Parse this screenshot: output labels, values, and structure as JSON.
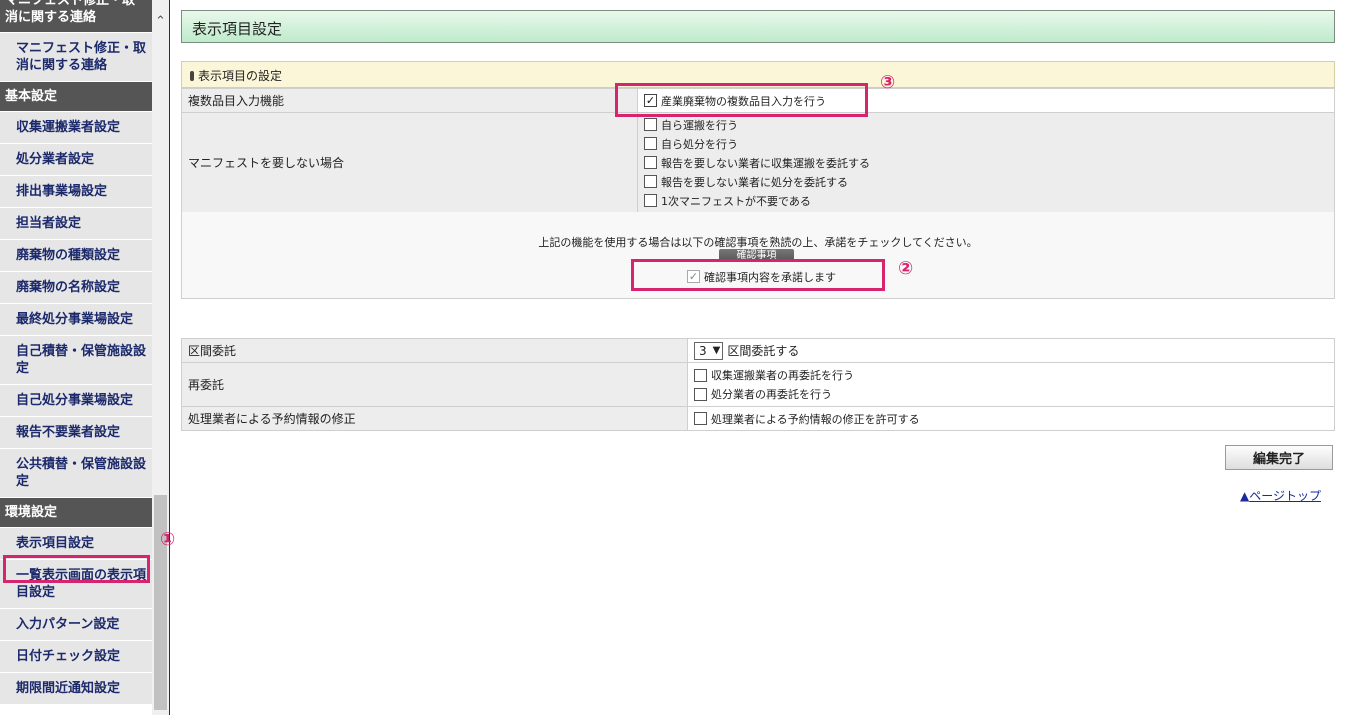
{
  "sidebar": {
    "items": [
      {
        "type": "header",
        "label": "マニフェスト修正・取消に関する連絡"
      },
      {
        "type": "item",
        "label": "マニフェスト修正・取消に関する連絡"
      },
      {
        "type": "header",
        "label": "基本設定"
      },
      {
        "type": "item",
        "label": "収集運搬業者設定"
      },
      {
        "type": "item",
        "label": "処分業者設定"
      },
      {
        "type": "item",
        "label": "排出事業場設定"
      },
      {
        "type": "item",
        "label": "担当者設定"
      },
      {
        "type": "item",
        "label": "廃棄物の種類設定"
      },
      {
        "type": "item",
        "label": "廃棄物の名称設定"
      },
      {
        "type": "item",
        "label": "最終処分事業場設定"
      },
      {
        "type": "item",
        "label": "自己積替・保管施設設定"
      },
      {
        "type": "item",
        "label": "自己処分事業場設定"
      },
      {
        "type": "item",
        "label": "報告不要業者設定"
      },
      {
        "type": "item",
        "label": "公共積替・保管施設設定"
      },
      {
        "type": "header",
        "label": "環境設定"
      },
      {
        "type": "item",
        "label": "表示項目設定"
      },
      {
        "type": "item",
        "label": "一覧表示画面の表示項目設定"
      },
      {
        "type": "item",
        "label": "入力パターン設定"
      },
      {
        "type": "item",
        "label": "日付チェック設定"
      },
      {
        "type": "item",
        "label": "期限間近通知設定"
      }
    ]
  },
  "header": {
    "title": "表示項目設定"
  },
  "section1": {
    "title": "表示項目の設定",
    "multi_item": {
      "label": "複数品目入力機能",
      "option": "産業廃棄物の複数品目入力を行う",
      "checked": true
    },
    "no_manifest": {
      "label": "マニフェストを要しない場合",
      "options": [
        "自ら運搬を行う",
        "自ら処分を行う",
        "報告を要しない業者に収集運搬を委託する",
        "報告を要しない業者に処分を委託する",
        "1次マニフェストが不要である"
      ]
    },
    "confirm": {
      "message": "上記の機能を使用する場合は以下の確認事項を熟読の上、承諾をチェックしてください。",
      "button": "確認事項",
      "approve": "確認事項内容を承諾します"
    }
  },
  "section2": {
    "kukan": {
      "label": "区間委託",
      "select_value": "3",
      "suffix": "区間委託する"
    },
    "reitaku": {
      "label": "再委託",
      "options": [
        "収集運搬業者の再委託を行う",
        "処分業者の再委託を行う"
      ]
    },
    "shusei": {
      "label": "処理業者による予約情報の修正",
      "option": "処理業者による予約情報の修正を許可する"
    }
  },
  "buttons": {
    "edit_done": "編集完了"
  },
  "links": {
    "page_top": "ページトップ"
  },
  "annotations": {
    "n1": "①",
    "n2": "②",
    "n3": "③"
  },
  "colors": {
    "highlight": "#d6246e",
    "sidebar_header": "#555555",
    "header_green": "#bfeacc"
  }
}
